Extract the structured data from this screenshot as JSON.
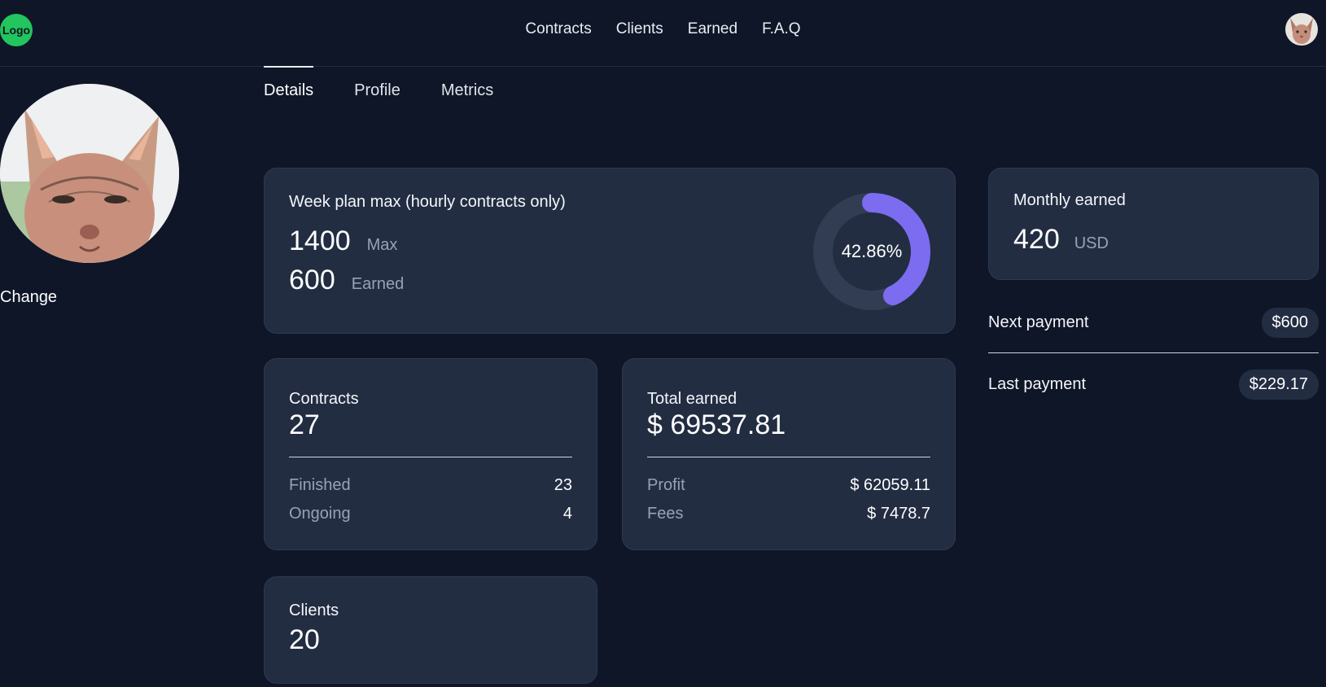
{
  "header": {
    "logo": "Logo",
    "nav": [
      "Contracts",
      "Clients",
      "Earned",
      "F.A.Q"
    ]
  },
  "profile": {
    "change_label": "Change"
  },
  "tabs": [
    {
      "label": "Details",
      "active": true
    },
    {
      "label": "Profile",
      "active": false
    },
    {
      "label": "Metrics",
      "active": false
    }
  ],
  "week_plan": {
    "title": "Week plan max (hourly contracts only)",
    "max_value": "1400",
    "max_label": "Max",
    "earned_value": "600",
    "earned_label": "Earned",
    "percent_label": "42.86%",
    "percent": 42.86
  },
  "contracts": {
    "title": "Contracts",
    "total": "27",
    "rows": [
      {
        "label": "Finished",
        "value": "23"
      },
      {
        "label": "Ongoing",
        "value": "4"
      }
    ]
  },
  "total_earned": {
    "title": "Total earned",
    "total": "$ 69537.81",
    "rows": [
      {
        "label": "Profit",
        "value": "$ 62059.11"
      },
      {
        "label": "Fees",
        "value": "$ 7478.7"
      }
    ]
  },
  "clients": {
    "title": "Clients",
    "total": "20"
  },
  "monthly": {
    "title": "Monthly earned",
    "value": "420",
    "unit": "USD"
  },
  "payments": {
    "next_label": "Next payment",
    "next_value": "$600",
    "last_label": "Last payment",
    "last_value": "$229.17"
  },
  "colors": {
    "background": "#0f1627",
    "card": "#222d42",
    "accent": "#7c6cf0",
    "logo": "#22c55e"
  }
}
